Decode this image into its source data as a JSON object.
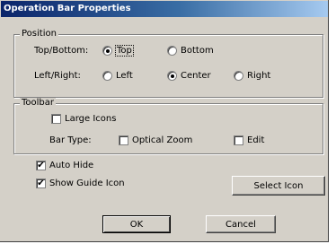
{
  "window": {
    "title": "Operation Bar Properties"
  },
  "position": {
    "group_label": "Position",
    "top_bottom": {
      "label": "Top/Bottom:",
      "options": [
        "Top",
        "Bottom"
      ],
      "selected": "Top"
    },
    "left_right": {
      "label": "Left/Right:",
      "options": [
        "Left",
        "Center",
        "Right"
      ],
      "selected": "Center"
    }
  },
  "toolbar": {
    "group_label": "Toolbar",
    "large_icons": {
      "label": "Large Icons",
      "checked": false
    },
    "bar_type": {
      "label": "Bar Type:",
      "optical_zoom": {
        "label": "Optical Zoom",
        "checked": false
      },
      "edit": {
        "label": "Edit",
        "checked": false
      }
    }
  },
  "auto_hide": {
    "label": "Auto Hide",
    "checked": true
  },
  "show_guide_icon": {
    "label": "Show Guide Icon",
    "checked": true
  },
  "buttons": {
    "select_icon": "Select Icon",
    "ok": "OK",
    "cancel": "Cancel"
  },
  "check_glyph": "✔"
}
